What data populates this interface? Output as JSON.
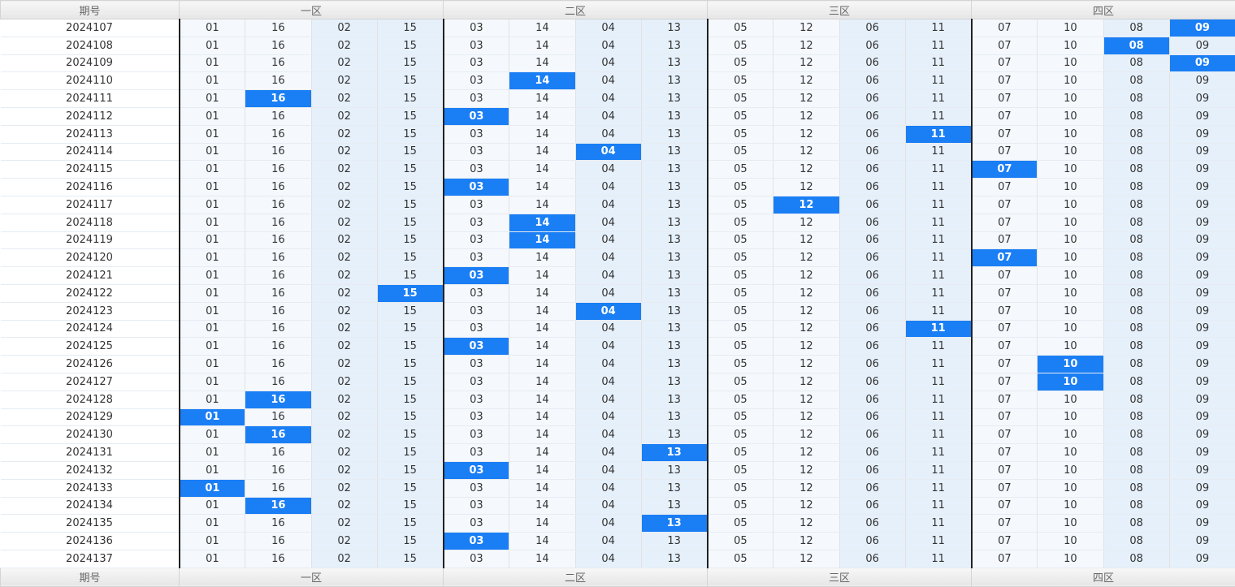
{
  "header": {
    "period_label": "期号",
    "zones": [
      "一区",
      "二区",
      "三区",
      "四区"
    ]
  },
  "numbers": [
    "01",
    "16",
    "02",
    "15",
    "03",
    "14",
    "04",
    "13",
    "05",
    "12",
    "06",
    "11",
    "07",
    "10",
    "08",
    "09"
  ],
  "rows": [
    {
      "period": "2024107",
      "hit": 15
    },
    {
      "period": "2024108",
      "hit": 14
    },
    {
      "period": "2024109",
      "hit": 15
    },
    {
      "period": "2024110",
      "hit": 5
    },
    {
      "period": "2024111",
      "hit": 1
    },
    {
      "period": "2024112",
      "hit": 4
    },
    {
      "period": "2024113",
      "hit": 11
    },
    {
      "period": "2024114",
      "hit": 6
    },
    {
      "period": "2024115",
      "hit": 12
    },
    {
      "period": "2024116",
      "hit": 4
    },
    {
      "period": "2024117",
      "hit": 9
    },
    {
      "period": "2024118",
      "hit": 5
    },
    {
      "period": "2024119",
      "hit": 5
    },
    {
      "period": "2024120",
      "hit": 12
    },
    {
      "period": "2024121",
      "hit": 4
    },
    {
      "period": "2024122",
      "hit": 3
    },
    {
      "period": "2024123",
      "hit": 6
    },
    {
      "period": "2024124",
      "hit": 11
    },
    {
      "period": "2024125",
      "hit": 4
    },
    {
      "period": "2024126",
      "hit": 13
    },
    {
      "period": "2024127",
      "hit": 13
    },
    {
      "period": "2024128",
      "hit": 1
    },
    {
      "period": "2024129",
      "hit": 0
    },
    {
      "period": "2024130",
      "hit": 1
    },
    {
      "period": "2024131",
      "hit": 7
    },
    {
      "period": "2024132",
      "hit": 4
    },
    {
      "period": "2024133",
      "hit": 0
    },
    {
      "period": "2024134",
      "hit": 1
    },
    {
      "period": "2024135",
      "hit": 7
    },
    {
      "period": "2024136",
      "hit": 4
    },
    {
      "period": "2024137",
      "hit": -1
    }
  ],
  "colors": {
    "hit": "#1a7ef5",
    "band_light": "#f5f9fd",
    "band_dark": "#e6f0fb"
  }
}
